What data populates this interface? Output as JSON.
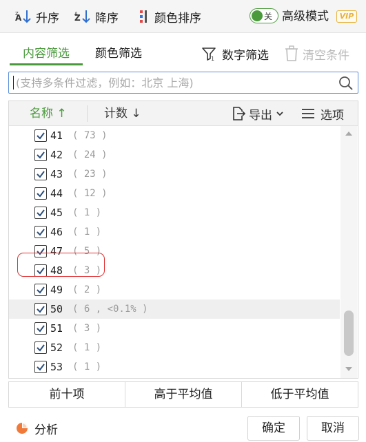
{
  "toolbar": {
    "sort_asc": "升序",
    "sort_desc": "降序",
    "color_sort": "颜色排序",
    "toggle_text": "关",
    "advanced_mode": "高级模式",
    "vip_badge": "VIP"
  },
  "tabs": {
    "content_filter": "内容筛选",
    "color_filter": "颜色筛选",
    "number_filter": "数字筛选",
    "clear_conditions": "清空条件"
  },
  "search": {
    "placeholder": "(支持多条件过滤，例如：北京 上海)",
    "value": ""
  },
  "list_header": {
    "name_label": "名称",
    "name_sort_arrow": "↑",
    "count_label": "计数",
    "count_sort_arrow": "↓",
    "export_label": "导出",
    "options_label": "选项"
  },
  "rows": [
    {
      "name": "41",
      "count": "( 73 )",
      "checked": true
    },
    {
      "name": "42",
      "count": "( 24 )",
      "checked": true
    },
    {
      "name": "43",
      "count": "( 23 )",
      "checked": true
    },
    {
      "name": "44",
      "count": "( 12 )",
      "checked": true
    },
    {
      "name": "45",
      "count": "( 1 )",
      "checked": true
    },
    {
      "name": "46",
      "count": "( 1 )",
      "checked": true
    },
    {
      "name": "47",
      "count": "( 5 )",
      "checked": true
    },
    {
      "name": "48",
      "count": "( 3 )",
      "checked": true
    },
    {
      "name": "49",
      "count": "( 2 )",
      "checked": true
    },
    {
      "name": "50",
      "count": "( 6 , <0.1% )",
      "checked": true,
      "highlighted": true
    },
    {
      "name": "51",
      "count": "( 3 )",
      "checked": true
    },
    {
      "name": "52",
      "count": "( 1 )",
      "checked": true
    },
    {
      "name": "53",
      "count": "( 1 )",
      "checked": true,
      "annotated": true
    }
  ],
  "quick_buttons": {
    "top_ten": "前十项",
    "above_average": "高于平均值",
    "below_average": "低于平均值"
  },
  "footer": {
    "analysis": "分析",
    "confirm": "确定",
    "cancel": "取消"
  },
  "colors": {
    "accent_green": "#4a9a3c",
    "search_border": "#5a8fd8",
    "vip_gold": "#e8b23a",
    "annotation_red": "#e03030",
    "analysis_orange": "#f07a3a"
  },
  "icons": {
    "sort_asc": "sort-ascending-icon",
    "sort_desc": "sort-descending-icon",
    "color_sort": "color-sort-icon",
    "number_filter": "funnel-icon",
    "clear_conditions": "trash-icon",
    "search": "search-icon",
    "export": "export-icon",
    "options": "menu-lines-icon",
    "analysis": "pie-chart-icon"
  }
}
